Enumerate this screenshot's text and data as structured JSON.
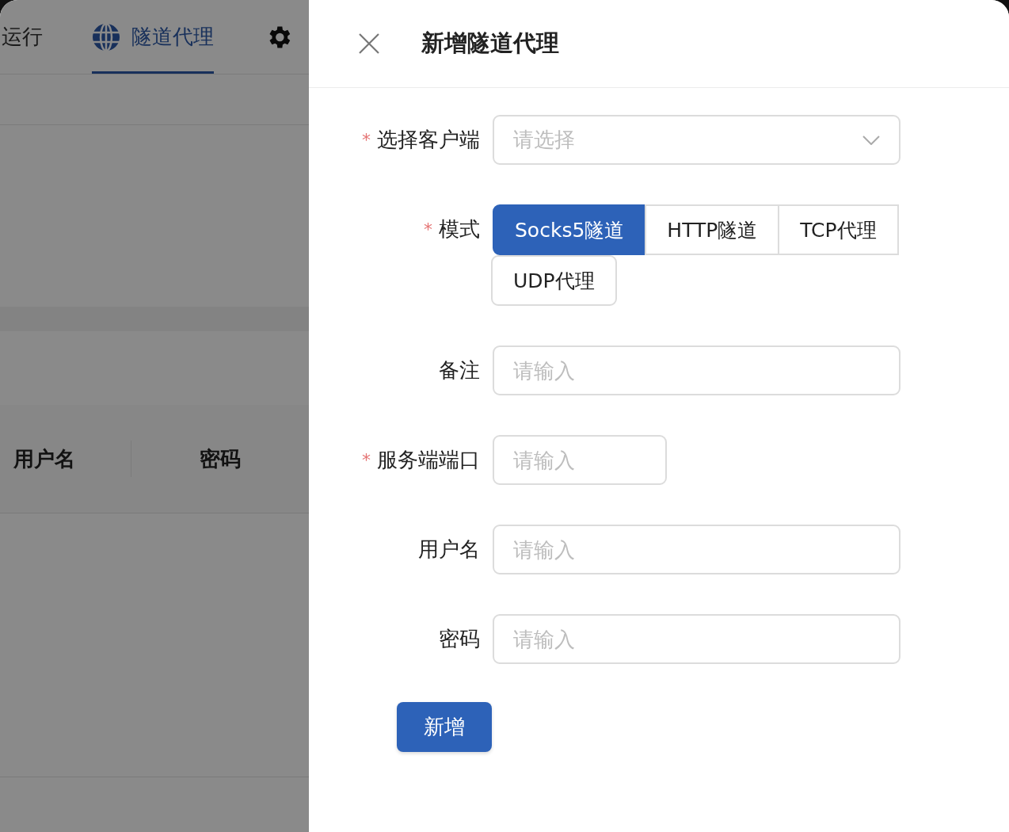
{
  "background": {
    "tabs": [
      {
        "label": "运行",
        "selected": false
      },
      {
        "label": "隧道代理",
        "selected": true
      }
    ],
    "table": {
      "columns": [
        "用户名",
        "密码"
      ]
    }
  },
  "drawer": {
    "title": "新增隧道代理",
    "fields": [
      {
        "kind": "select",
        "label": "选择客户端",
        "mark": "*",
        "placeholder": "请选择"
      },
      {
        "kind": "radio",
        "label": "模式",
        "mark": "*",
        "options": [
          {
            "label": "Socks5隧道",
            "selected": true
          },
          {
            "label": "HTTP隧道",
            "selected": false
          },
          {
            "label": "TCP代理",
            "selected": false
          },
          {
            "label": "UDP代理",
            "selected": false
          }
        ]
      },
      {
        "kind": "input",
        "label": "备注",
        "placeholder": "请输入"
      },
      {
        "kind": "short-input",
        "label": "服务端端口",
        "mark": "*",
        "placeholder": "请输入"
      },
      {
        "kind": "input",
        "label": "用户名",
        "placeholder": "请输入"
      },
      {
        "kind": "input",
        "label": "密码",
        "placeholder": "请输入"
      }
    ],
    "submit": "新增"
  }
}
